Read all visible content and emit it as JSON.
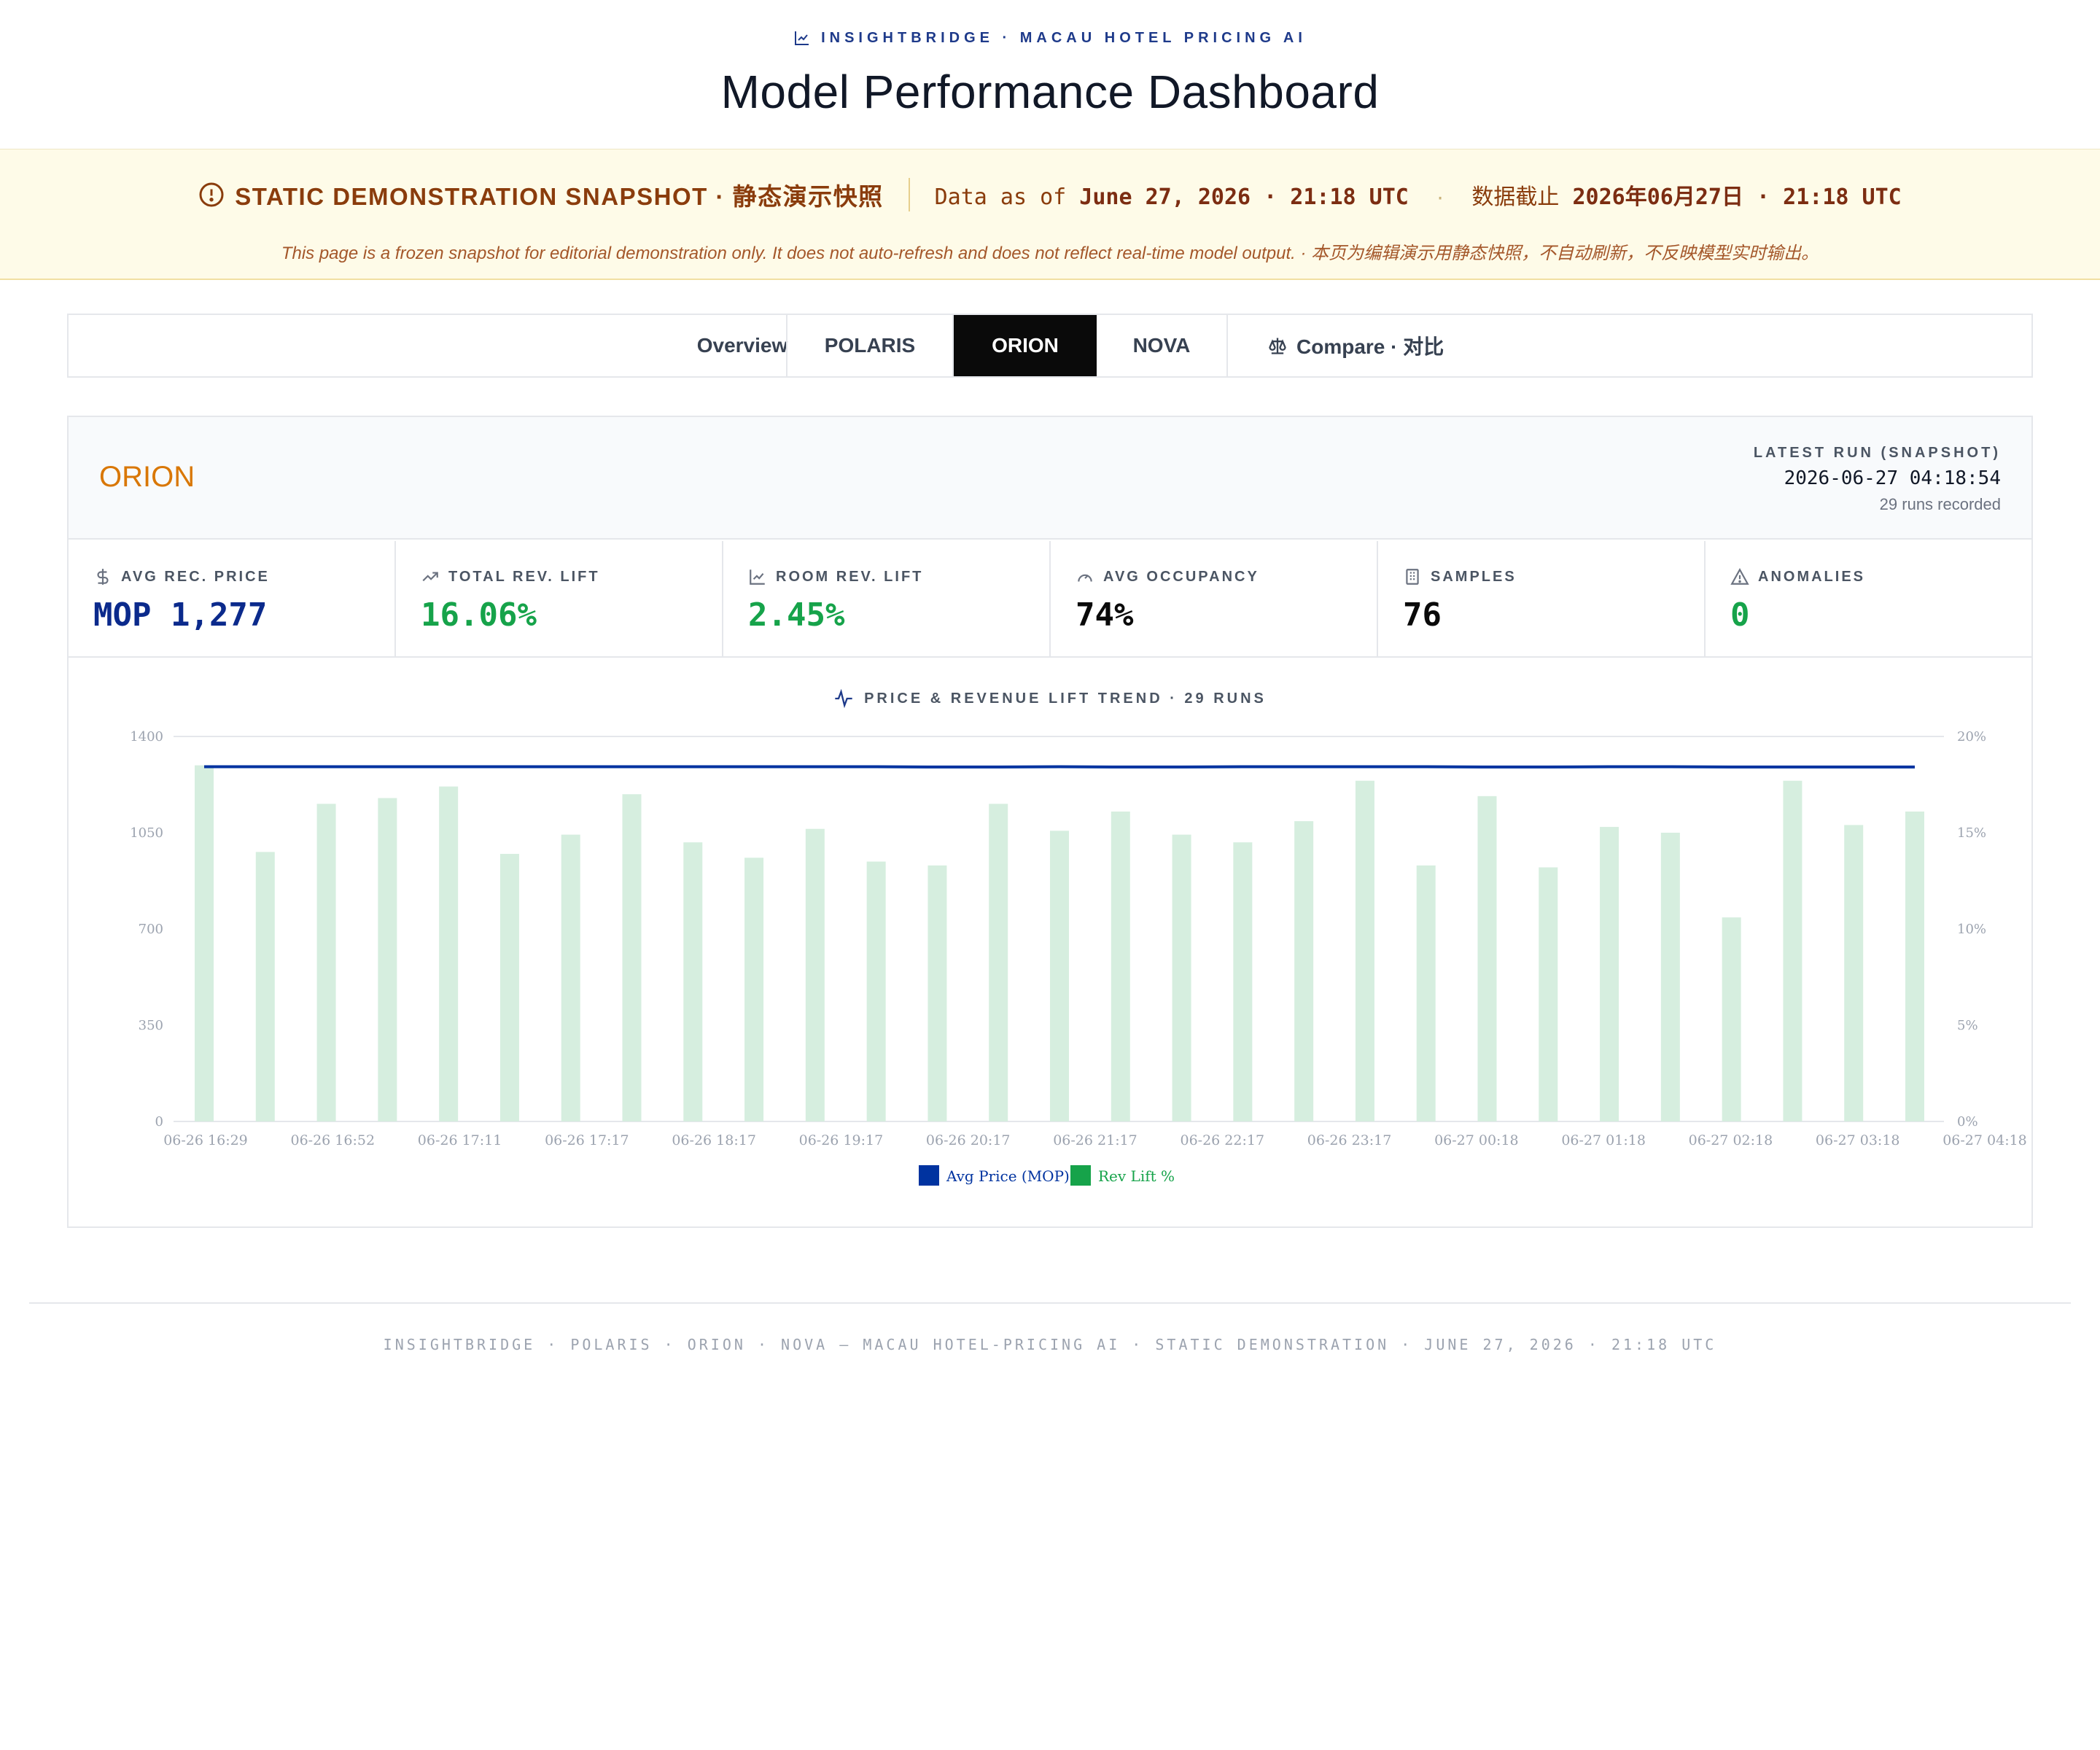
{
  "header": {
    "brand": "INSIGHTBRIDGE · MACAU HOTEL PRICING AI",
    "title": "Model Performance Dashboard"
  },
  "banner": {
    "title": "STATIC DEMONSTRATION SNAPSHOT · 静态演示快照",
    "asof_prefix": "Data as of",
    "asof_date": "June 27, 2026 · 21:18 UTC",
    "asof_prefix_zh": "数据截止",
    "asof_date_zh": "2026年06月27日 · 21:18 UTC",
    "note": "This page is a frozen snapshot for editorial demonstration only. It does not auto-refresh and does not reflect real-time model output. · 本页为编辑演示用静态快照，不自动刷新，不反映模型实时输出。"
  },
  "tabs": [
    {
      "label": "Overview"
    },
    {
      "label": "POLARIS"
    },
    {
      "label": "ORION",
      "active": true
    },
    {
      "label": "NOVA"
    },
    {
      "label": "Compare · 对比"
    }
  ],
  "model": {
    "name": "ORION",
    "latest_label": "LATEST RUN (SNAPSHOT)",
    "latest_ts": "2026-06-27 04:18:54",
    "runs_recorded": "29 runs recorded"
  },
  "kpis": [
    {
      "label": "AVG REC. PRICE",
      "value": "MOP 1,277",
      "icon": "dollar-icon",
      "tone": "blue"
    },
    {
      "label": "TOTAL REV. LIFT",
      "value": "16.06%",
      "icon": "trending-up-icon",
      "tone": "green"
    },
    {
      "label": "ROOM REV. LIFT",
      "value": "2.45%",
      "icon": "line-chart-icon",
      "tone": "green"
    },
    {
      "label": "AVG OCCUPANCY",
      "value": "74%",
      "icon": "gauge-icon",
      "tone": "black"
    },
    {
      "label": "SAMPLES",
      "value": "76",
      "icon": "building-icon",
      "tone": "black"
    },
    {
      "label": "ANOMALIES",
      "value": "0",
      "icon": "warning-icon",
      "tone": "green"
    }
  ],
  "chart_title": "PRICE & REVENUE LIFT TREND · 29 RUNS",
  "colors": {
    "accent_blue": "#0b2a8c",
    "price_line": "#0033a0",
    "lift_bar": "#d6eedf",
    "lift_legend": "#16a34a",
    "model_name": "#d97706",
    "banner_text": "#8a3c0c"
  },
  "chart_data": {
    "type": "bar",
    "title": "PRICE & REVENUE LIFT TREND · 29 RUNS",
    "x_tick_labels": [
      "06-26 16:29",
      "06-26 16:52",
      "06-26 17:11",
      "06-26 17:17",
      "06-26 18:17",
      "06-26 19:17",
      "06-26 20:17",
      "06-26 21:17",
      "06-26 22:17",
      "06-26 23:17",
      "06-27 00:18",
      "06-27 01:18",
      "06-27 02:18",
      "06-27 03:18",
      "06-27 04:18"
    ],
    "y_left": {
      "ticks": [
        "0",
        "350",
        "700",
        "1050",
        "1400"
      ],
      "range": [
        0,
        1400
      ]
    },
    "y_right": {
      "ticks": [
        "0%",
        "5%",
        "10%",
        "15%",
        "20%"
      ],
      "range": [
        0,
        20
      ]
    },
    "grid": "horizontal at top only",
    "legend_position": "bottom-center",
    "series": [
      {
        "name": "Avg Price (MOP)",
        "type": "line",
        "axis": "left",
        "values": [
          1290,
          1290,
          1290,
          1290,
          1290,
          1290,
          1290,
          1290,
          1290,
          1290,
          1290,
          1290,
          1289,
          1289,
          1290,
          1289,
          1289,
          1290,
          1290,
          1290,
          1290,
          1289,
          1289,
          1290,
          1290,
          1289,
          1289,
          1289,
          1289
        ]
      },
      {
        "name": "Rev Lift %",
        "type": "bar",
        "axis": "right",
        "values": [
          18.5,
          14.0,
          16.5,
          16.8,
          17.4,
          13.9,
          14.9,
          17.0,
          14.5,
          13.7,
          15.2,
          13.5,
          13.3,
          16.5,
          15.1,
          16.1,
          14.9,
          14.5,
          15.6,
          17.7,
          13.3,
          16.9,
          13.2,
          15.3,
          15.0,
          10.6,
          17.7,
          15.4,
          16.1
        ]
      }
    ]
  },
  "footer": "INSIGHTBRIDGE · POLARIS · ORION · NOVA — MACAU HOTEL-PRICING AI · STATIC DEMONSTRATION · JUNE 27, 2026 · 21:18 UTC"
}
